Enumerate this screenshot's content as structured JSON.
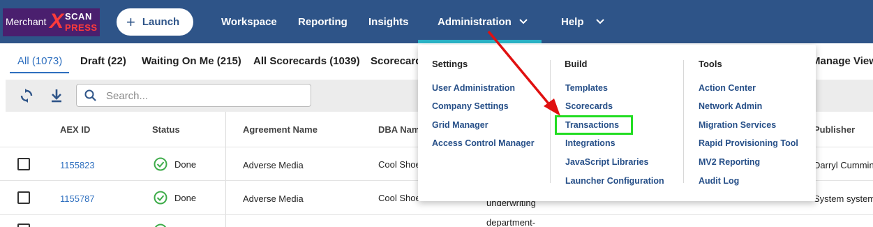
{
  "logo": {
    "merchant": "Merchant",
    "x": "X",
    "scan": "SCAN",
    "press": "PRESS"
  },
  "header": {
    "launch_label": "Launch",
    "nav": [
      "Workspace",
      "Reporting",
      "Insights",
      "Administration",
      "Help"
    ]
  },
  "tabs": {
    "items": [
      "All (1073)",
      "Draft (22)",
      "Waiting On Me (215)",
      "All Scorecards (1039)",
      "Scorecard"
    ],
    "manage_views": "Manage Views",
    "active_index": 0
  },
  "toolbar": {
    "search_placeholder": "Search..."
  },
  "table": {
    "headers": [
      "AEX ID",
      "Status",
      "Agreement Name",
      "DBA Nam",
      "Publisher"
    ],
    "rows": [
      {
        "aex_id": "1155823",
        "status": "Done",
        "agreement": "Adverse Media",
        "dba": "Cool Shoe",
        "publisher": "Darryl Cummin"
      },
      {
        "aex_id": "1155787",
        "status": "Done",
        "agreement": "Adverse Media",
        "dba": "Cool Shoe",
        "publisher": "System system"
      }
    ],
    "overflow_text": [
      "underwriting",
      "department-"
    ]
  },
  "dropdown": {
    "settings": {
      "heading": "Settings",
      "items": [
        "User Administration",
        "Company Settings",
        "Grid Manager",
        "Access Control Manager"
      ]
    },
    "build": {
      "heading": "Build",
      "items": [
        "Templates",
        "Scorecards",
        "Transactions",
        "Integrations",
        "JavaScript Libraries",
        "Launcher Configuration"
      ]
    },
    "tools": {
      "heading": "Tools",
      "items": [
        "Action Center",
        "Network Admin",
        "Migration Services",
        "Rapid Provisioning Tool",
        "MV2 Reporting",
        "Audit Log"
      ]
    }
  },
  "colors": {
    "header_bg": "#2e5488",
    "accent": "#2bb5c8",
    "link": "#264f88",
    "annotation_arrow": "#e01010",
    "annotation_box": "#22dd22"
  }
}
